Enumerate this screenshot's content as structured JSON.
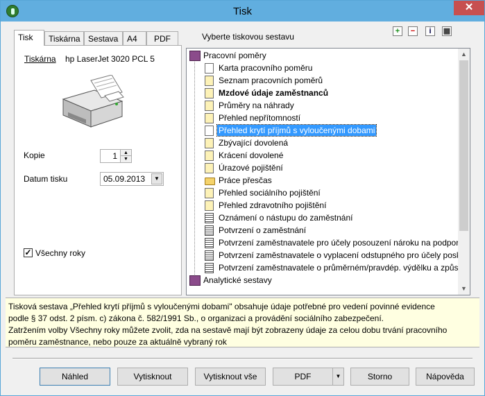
{
  "window": {
    "title": "Tisk"
  },
  "tabs": [
    {
      "label": "Tisk",
      "active": true
    },
    {
      "label": "Tiskárna",
      "active": false
    },
    {
      "label": "Sestava",
      "active": false
    },
    {
      "label": "A4",
      "active": false
    },
    {
      "label": "PDF",
      "active": false
    }
  ],
  "heading": "Vyberte tiskovou sestavu",
  "toolbar": {
    "icons": [
      "add-icon",
      "remove-icon",
      "info-icon",
      "settings-icon"
    ]
  },
  "left": {
    "printer_label": "Tiskárna",
    "printer_name": "hp LaserJet 3020 PCL 5",
    "copies_label": "Kopie",
    "copies_value": "1",
    "date_label": "Datum tisku",
    "date_value": "05.09.2013",
    "all_years_label": "Všechny roky",
    "all_years_checked": true
  },
  "tree": {
    "root": "Pracovní poměry",
    "items": [
      {
        "label": "Karta pracovního poměru",
        "icon": "doc-white"
      },
      {
        "label": "Seznam pracovních poměrů",
        "icon": "doc-yellow"
      },
      {
        "label": "Mzdové údaje zaměstnanců",
        "icon": "doc-yellow",
        "bold": true
      },
      {
        "label": "Průměry na náhrady",
        "icon": "doc-yellow"
      },
      {
        "label": "Přehled nepřítomností",
        "icon": "doc-yellow"
      },
      {
        "label": "Přehled krytí příjmů s vyloučenými dobami",
        "icon": "doc-white",
        "selected": true
      },
      {
        "label": "Zbývající dovolená",
        "icon": "doc-yellow"
      },
      {
        "label": "Krácení dovolené",
        "icon": "doc-yellow"
      },
      {
        "label": "Úrazové pojištění",
        "icon": "doc-yellow"
      },
      {
        "label": "Práce přesčas",
        "icon": "folder"
      },
      {
        "label": "Přehled sociálního pojištění",
        "icon": "doc-yellow"
      },
      {
        "label": "Přehled zdravotního pojištění",
        "icon": "doc-yellow"
      },
      {
        "label": "Oznámení o nástupu do zaměstnání",
        "icon": "doc-lines"
      },
      {
        "label": "Potvrzení o zaměstnání",
        "icon": "doc-lines"
      },
      {
        "label": "Potvrzení zaměstnavatele pro účely posouzení nároku na podporu",
        "icon": "doc-lines"
      },
      {
        "label": "Potvrzení zaměstnavatele o vyplacení odstupného pro účely posk",
        "icon": "doc-lines"
      },
      {
        "label": "Potvrzení zaměstnavatele o průměrném/pravdép. výdělku a způsc",
        "icon": "doc-lines"
      }
    ],
    "second_root": "Analytické sestavy"
  },
  "description": {
    "line1": "Tisková sestava „Přehled krytí příjmů s vyloučenými dobami\" obsahuje údaje potřebné pro vedení povinné evidence",
    "line2": "podle § 37 odst. 2 písm. c) zákona č. 582/1991 Sb., o organizaci a provádění sociálního zabezpečení.",
    "line3": "Zatržením volby Všechny roky můžete zvolit, zda na sestavě mají být zobrazeny údaje za celou dobu trvání pracovního",
    "line4": "poměru zaměstnance, nebo pouze za aktuálně vybraný rok"
  },
  "buttons": {
    "preview": "Náhled",
    "print": "Vytisknout",
    "print_all": "Vytisknout vše",
    "pdf": "PDF",
    "cancel": "Storno",
    "help": "Nápověda"
  }
}
